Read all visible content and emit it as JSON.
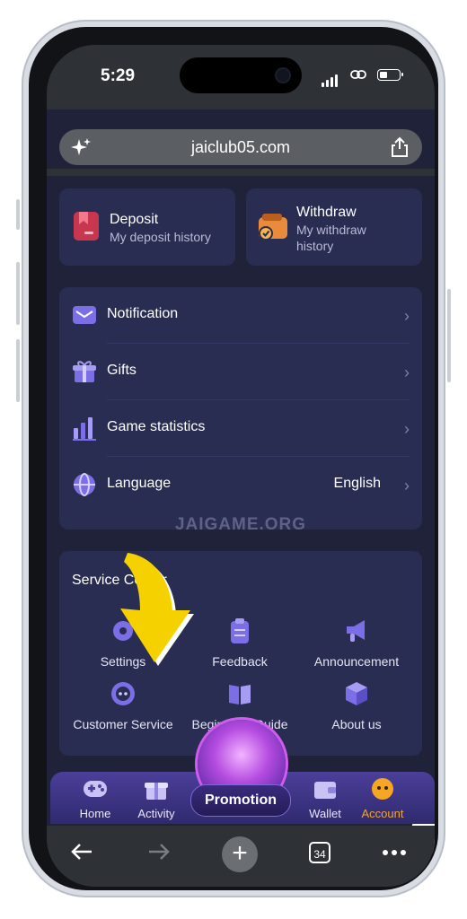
{
  "status": {
    "time": "5:29"
  },
  "browser": {
    "url": "jaiclub05.com",
    "tab_count": "34"
  },
  "top_cards": {
    "deposit": {
      "title": "Deposit",
      "subtitle": "My deposit history"
    },
    "withdraw": {
      "title": "Withdraw",
      "subtitle_line1": "My withdraw",
      "subtitle_line2": "history"
    }
  },
  "menu": {
    "items": [
      {
        "label": "Notification",
        "icon": "envelope-icon"
      },
      {
        "label": "Gifts",
        "icon": "gift-icon"
      },
      {
        "label": "Game statistics",
        "icon": "bar-chart-icon"
      },
      {
        "label": "Language",
        "icon": "globe-icon",
        "value": "English"
      }
    ]
  },
  "watermark": "JAIGAME.ORG",
  "service_center": {
    "title": "Service Center",
    "items": [
      {
        "label": "Settings",
        "icon": "settings-icon"
      },
      {
        "label": "Feedback",
        "icon": "clipboard-icon"
      },
      {
        "label": "Announcement",
        "icon": "megaphone-icon"
      },
      {
        "label": "Customer Service",
        "icon": "headset-icon"
      },
      {
        "label": "Beginner's Guide",
        "icon": "book-icon"
      },
      {
        "label": "About us",
        "icon": "cube-icon"
      }
    ]
  },
  "bottom_nav": {
    "home": "Home",
    "activity": "Activity",
    "promotion": "Promotion",
    "wallet": "Wallet",
    "account": "Account"
  },
  "colors": {
    "background": "#1f2239",
    "card": "#2a2d52",
    "accent": "#7c6ee6",
    "account_active": "#f5a623",
    "arrow": "#f5d100"
  }
}
